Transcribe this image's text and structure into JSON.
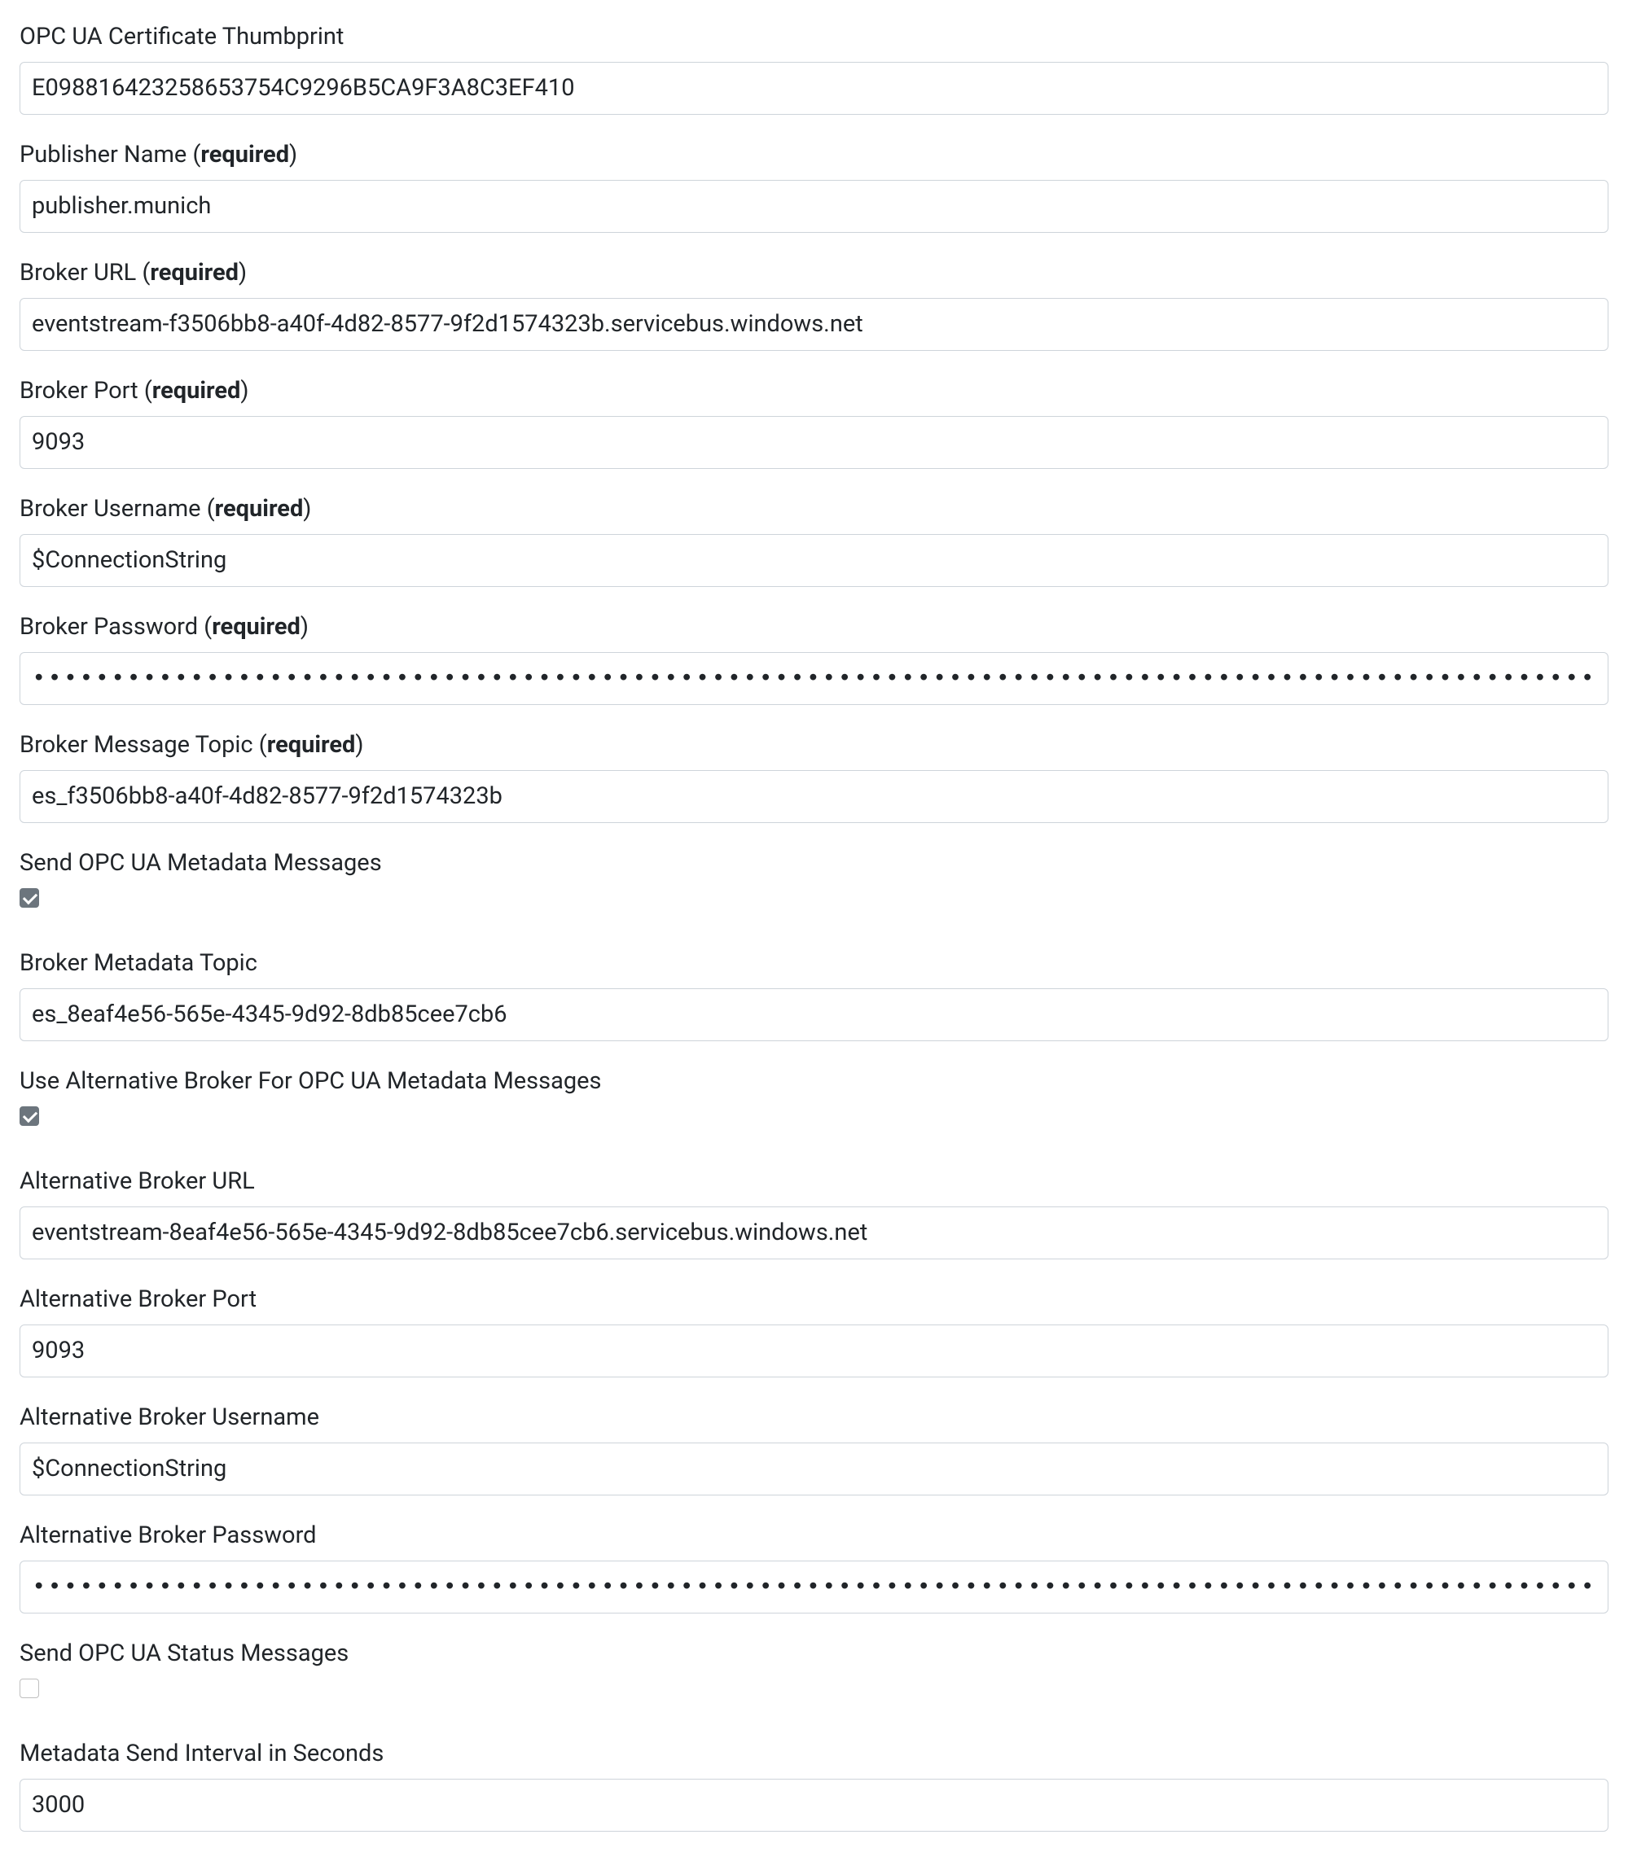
{
  "form": {
    "required_suffix": "required",
    "thumbprint": {
      "label": "OPC UA Certificate Thumbprint",
      "value": "E098816423258653754C9296B5CA9F3A8C3EF410"
    },
    "publisher_name": {
      "label": "Publisher Name (",
      "value": "publisher.munich"
    },
    "broker_url": {
      "label": "Broker URL (",
      "value": "eventstream-f3506bb8-a40f-4d82-8577-9f2d1574323b.servicebus.windows.net"
    },
    "broker_port": {
      "label": "Broker Port (",
      "value": "9093"
    },
    "broker_username": {
      "label": "Broker Username (",
      "value": "$ConnectionString"
    },
    "broker_password": {
      "label": "Broker Password (",
      "value": "•••••••••••••••••••••••••••••••••••••••••••••••••••••••••••••••••••••••••••••••••••••••••••••••••••••••••••••••••••••••••••••••••••••••••••••••••••••••••••••••••••••••••••••••••••••••••••••••••••••••"
    },
    "broker_topic": {
      "label": "Broker Message Topic (",
      "value": "es_f3506bb8-a40f-4d82-8577-9f2d1574323b"
    },
    "send_metadata": {
      "label": "Send OPC UA Metadata Messages",
      "checked": true
    },
    "metadata_topic": {
      "label": "Broker Metadata Topic",
      "value": "es_8eaf4e56-565e-4345-9d92-8db85cee7cb6"
    },
    "use_alt_broker": {
      "label": "Use Alternative Broker For OPC UA Metadata Messages",
      "checked": true
    },
    "alt_broker_url": {
      "label": "Alternative Broker URL",
      "value": "eventstream-8eaf4e56-565e-4345-9d92-8db85cee7cb6.servicebus.windows.net"
    },
    "alt_broker_port": {
      "label": "Alternative Broker Port",
      "value": "9093"
    },
    "alt_broker_username": {
      "label": "Alternative Broker Username",
      "value": "$ConnectionString"
    },
    "alt_broker_password": {
      "label": "Alternative Broker Password",
      "value": "•••••••••••••••••••••••••••••••••••••••••••••••••••••••••••••••••••••••••••••••••••••••••••••••••••••••••••••••••••••••••••••••••••••••••••••••••••••••••••••••••••••••••••••••••••••••••••••••••••••••"
    },
    "send_status": {
      "label": "Send OPC UA Status Messages",
      "checked": false
    },
    "metadata_interval": {
      "label": "Metadata Send Interval in Seconds",
      "value": "3000"
    }
  }
}
